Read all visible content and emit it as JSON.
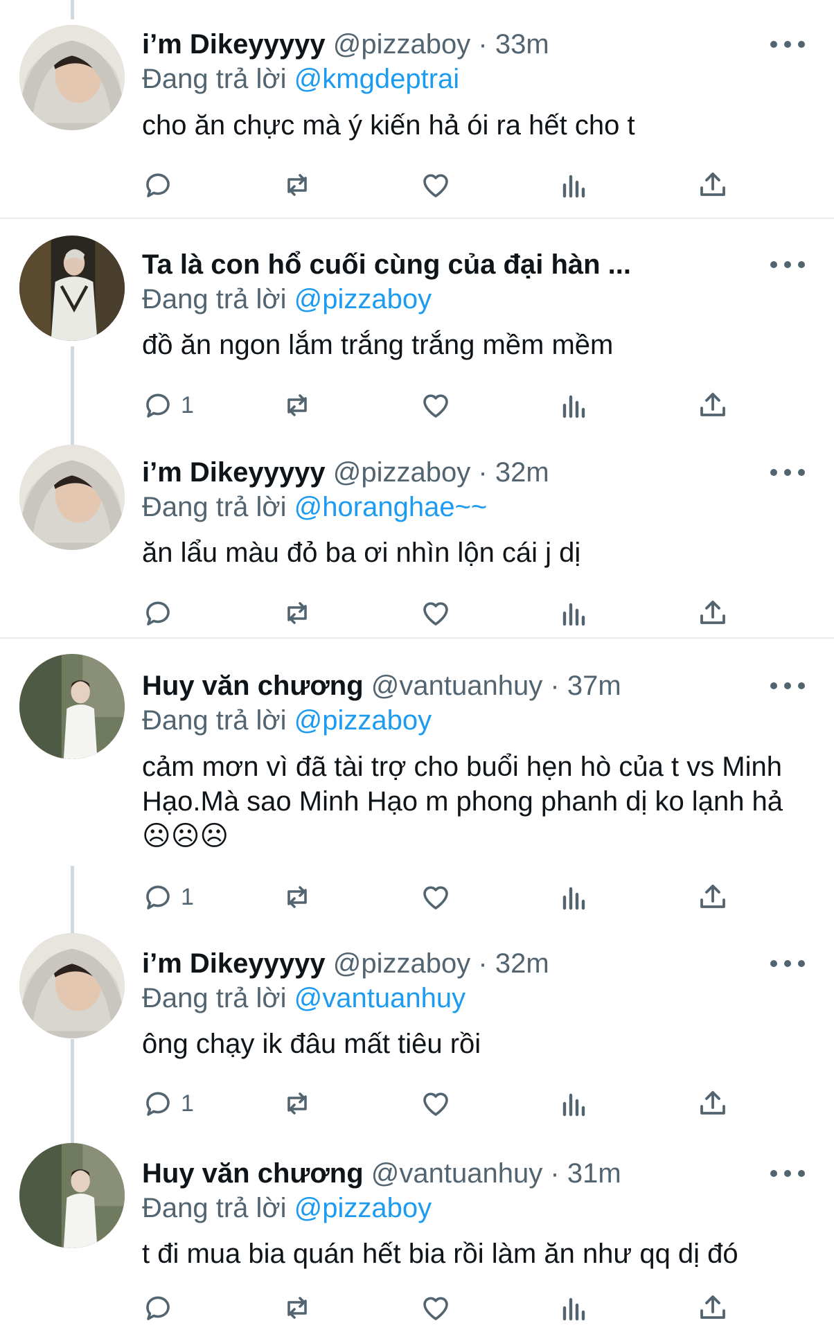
{
  "reply_prefix": "Đang trả lời",
  "tweets": [
    {
      "name": "i’m Dikeyyyyy",
      "handle": "@pizzaboy",
      "separator": "·",
      "time": "33m",
      "reply_to": "@kmgdeptrai",
      "text": "cho ăn chực mà ý kiến hả ói ra hết cho t",
      "reply_count": "",
      "avatar": "dikey"
    },
    {
      "name": "Ta là con hổ cuối cùng của đại hàn ...",
      "handle": "",
      "separator": "",
      "time": "",
      "reply_to": "@pizzaboy",
      "text": "đồ ăn ngon lắm trắng trắng mềm mềm",
      "reply_count": "1",
      "avatar": "tiger"
    },
    {
      "name": "i’m Dikeyyyyy",
      "handle": "@pizzaboy",
      "separator": "·",
      "time": "32m",
      "reply_to": "@horanghae~~",
      "text": "ăn lẩu màu đỏ ba ơi nhìn lộn cái j dị",
      "reply_count": "",
      "avatar": "dikey"
    },
    {
      "name": "Huy văn chương",
      "handle": "@vantuanhuy",
      "separator": "·",
      "time": "37m",
      "reply_to": "@pizzaboy",
      "text": "cảm mơn vì đã tài trợ cho buổi hẹn hò của t vs Minh Hạo.Mà sao Minh Hạo m phong phanh dị ko lạnh hả ☹☹☹",
      "reply_count": "1",
      "avatar": "huy"
    },
    {
      "name": "i’m Dikeyyyyy",
      "handle": "@pizzaboy",
      "separator": "·",
      "time": "32m",
      "reply_to": "@vantuanhuy",
      "text": "ông chạy ik đâu mất tiêu rồi",
      "reply_count": "1",
      "avatar": "dikey"
    },
    {
      "name": "Huy văn chương",
      "handle": "@vantuanhuy",
      "separator": "·",
      "time": "31m",
      "reply_to": "@pizzaboy",
      "text": "t đi mua bia quán hết bia rồi làm ăn như qq dị đó",
      "reply_count": "",
      "avatar": "huy"
    }
  ],
  "icons": {
    "reply": "reply-icon",
    "retweet": "retweet-icon",
    "like": "heart-icon",
    "views": "views-icon",
    "share": "share-icon",
    "more": "more-icon"
  },
  "colors": {
    "mention": "#1d9bf0",
    "secondary": "#536471",
    "thread_line": "#cfd9de"
  }
}
